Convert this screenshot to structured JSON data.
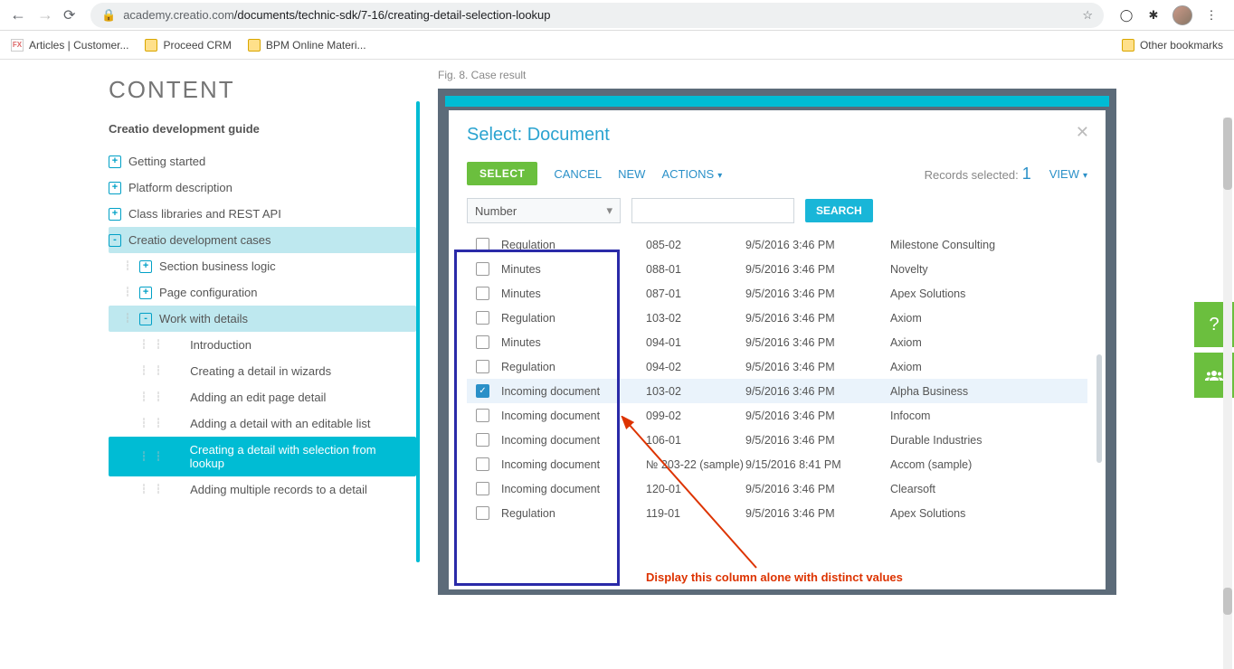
{
  "browser": {
    "url_host": "academy.creatio.com",
    "url_path": "/documents/technic-sdk/7-16/creating-detail-selection-lookup",
    "bookmarks": [
      "Articles | Customer...",
      "Proceed CRM",
      "BPM Online Materi..."
    ],
    "other_bookmarks": "Other bookmarks"
  },
  "content": {
    "title": "CONTENT",
    "subtitle": "Creatio development guide",
    "tree": [
      {
        "label": "Getting started",
        "level": 1,
        "exp": "+"
      },
      {
        "label": "Platform description",
        "level": 1,
        "exp": "+"
      },
      {
        "label": "Class libraries and REST API",
        "level": 1,
        "exp": "+"
      },
      {
        "label": "Creatio development cases",
        "level": 1,
        "exp": "-",
        "open": true
      },
      {
        "label": "Section business logic",
        "level": 2,
        "exp": "+"
      },
      {
        "label": "Page configuration",
        "level": 2,
        "exp": "+"
      },
      {
        "label": "Work with details",
        "level": 2,
        "exp": "-",
        "open": true
      },
      {
        "label": "Introduction",
        "level": 3
      },
      {
        "label": "Creating a detail in wizards",
        "level": 3
      },
      {
        "label": "Adding an edit page detail",
        "level": 3
      },
      {
        "label": "Adding a detail with an editable list",
        "level": 3
      },
      {
        "label": "Creating a detail with selection from lookup",
        "level": 3,
        "active": true
      },
      {
        "label": "Adding multiple records to a detail",
        "level": 3
      }
    ]
  },
  "figure": {
    "caption": "Fig. 8. Case result",
    "modal_title": "Select: Document",
    "buttons": {
      "select": "SELECT",
      "cancel": "CANCEL",
      "new": "NEW",
      "actions": "ACTIONS",
      "view": "VIEW"
    },
    "records_label": "Records selected:",
    "records_count": "1",
    "filter_field": "Number",
    "search_btn": "SEARCH",
    "annotation": "Display this column alone with distinct values",
    "rows": [
      {
        "type": "Regulation",
        "num": "085-02",
        "date": "9/5/2016 3:46 PM",
        "acct": "Milestone Consulting"
      },
      {
        "type": "Minutes",
        "num": "088-01",
        "date": "9/5/2016 3:46 PM",
        "acct": "Novelty"
      },
      {
        "type": "Minutes",
        "num": "087-01",
        "date": "9/5/2016 3:46 PM",
        "acct": "Apex Solutions"
      },
      {
        "type": "Regulation",
        "num": "103-02",
        "date": "9/5/2016 3:46 PM",
        "acct": "Axiom"
      },
      {
        "type": "Minutes",
        "num": "094-01",
        "date": "9/5/2016 3:46 PM",
        "acct": "Axiom"
      },
      {
        "type": "Regulation",
        "num": "094-02",
        "date": "9/5/2016 3:46 PM",
        "acct": "Axiom"
      },
      {
        "type": "Incoming document",
        "num": "103-02",
        "date": "9/5/2016 3:46 PM",
        "acct": "Alpha Business",
        "checked": true
      },
      {
        "type": "Incoming document",
        "num": "099-02",
        "date": "9/5/2016 3:46 PM",
        "acct": "Infocom"
      },
      {
        "type": "Incoming document",
        "num": "106-01",
        "date": "9/5/2016 3:46 PM",
        "acct": "Durable Industries"
      },
      {
        "type": "Incoming document",
        "num": "№ 203-22 (sample)",
        "date": "9/15/2016 8:41 PM",
        "acct": "Accom (sample)"
      },
      {
        "type": "Incoming document",
        "num": "120-01",
        "date": "9/5/2016 3:46 PM",
        "acct": "Clearsoft"
      },
      {
        "type": "Regulation",
        "num": "119-01",
        "date": "9/5/2016 3:46 PM",
        "acct": "Apex Solutions"
      }
    ]
  }
}
